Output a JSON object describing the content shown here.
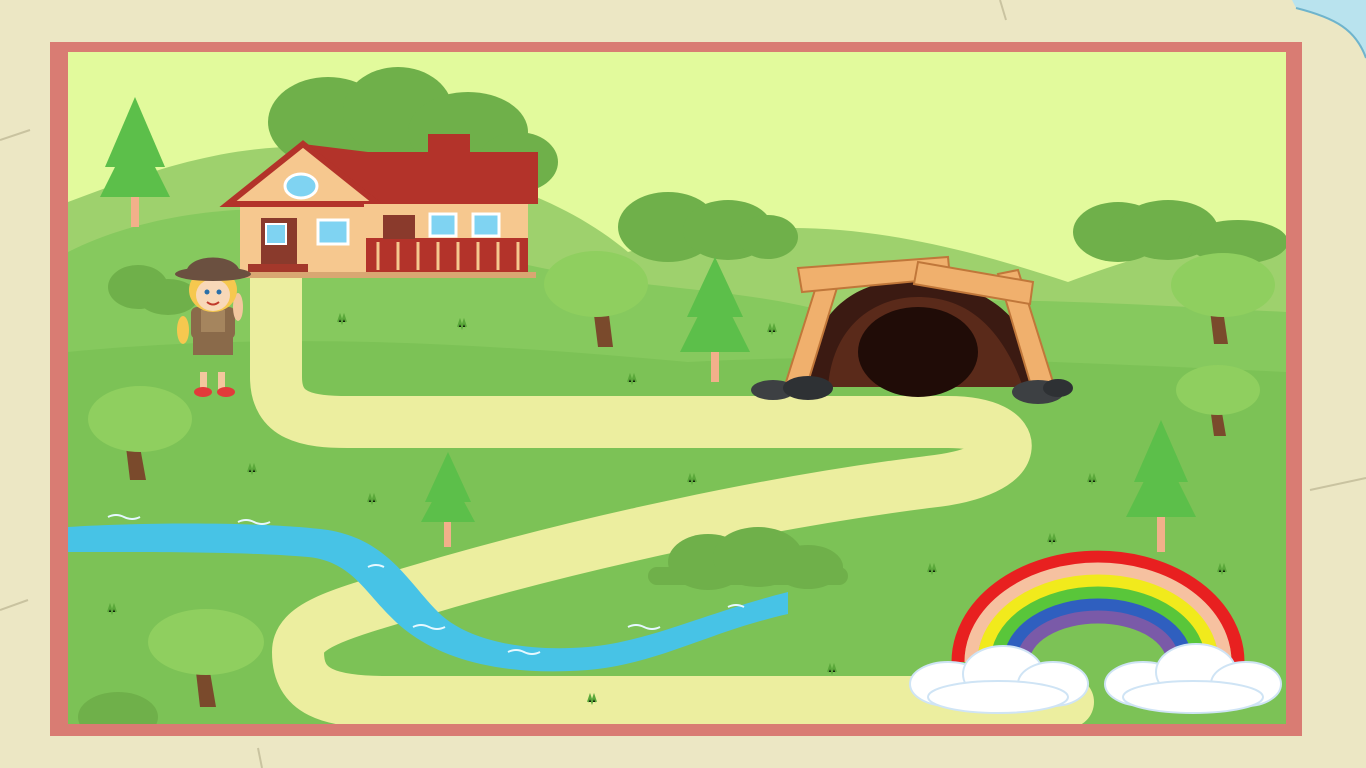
{
  "scene": {
    "type": "adventure-map",
    "theme_colors": {
      "paper": "#ece7c4",
      "frame": "#d97c73",
      "sky": "#e2fa9c",
      "grass": "#7fc55a",
      "path": "#ecee9f",
      "river": "#47c3e6",
      "roof": "#b3332a",
      "house_wall": "#f6c88f"
    },
    "locations": [
      {
        "id": "house",
        "icon": "house-icon"
      },
      {
        "id": "cave",
        "icon": "cave-icon"
      },
      {
        "id": "river",
        "icon": "river-icon"
      },
      {
        "id": "rainbow",
        "icon": "rainbow-icon"
      }
    ],
    "player": {
      "id": "explorer-girl",
      "icon": "explorer-girl-icon",
      "at": "house"
    }
  }
}
